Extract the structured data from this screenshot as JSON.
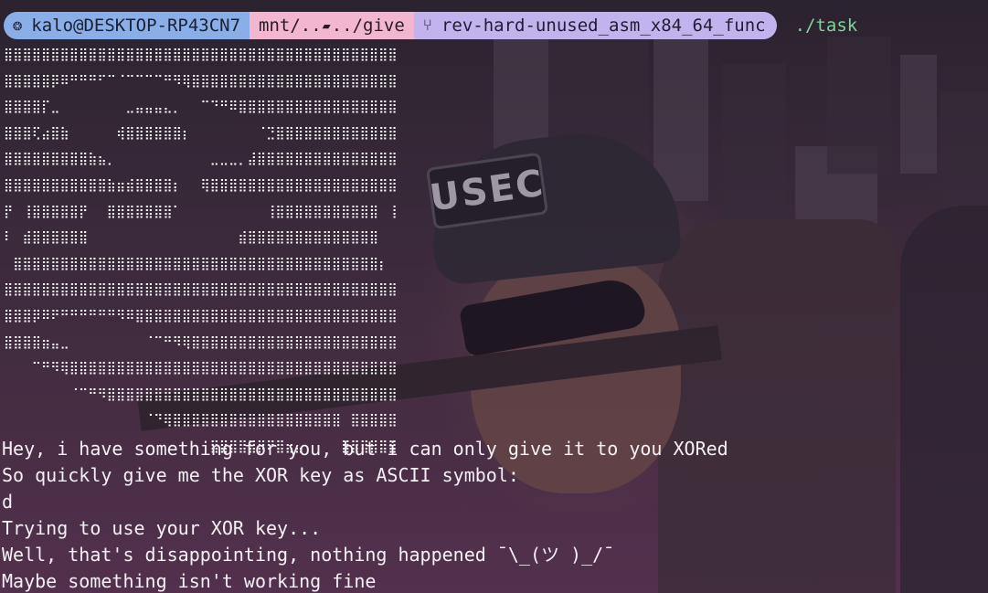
{
  "prompt": {
    "user_icon": "os-logo-icon",
    "user": "kalo@DESKTOP-RP43CN7",
    "path_start": "mnt/..",
    "path_icon": "folder-icon",
    "path_end": "../give",
    "branch_icon": "git-branch-icon",
    "branch": "rev-hard-unused_asm_x84_64_func",
    "command": "./task"
  },
  "ascii_art": [
    "⣿⣿⣿⣿⣿⣿⣿⣿⣿⣿⣿⣿⣿⣿⣿⣿⣿⣿⣿⣿⣿⣿⣿⣿⣿⣿⣿⣿⣿⣿⣿⣿⣿⣿⣿⣿⣿⣿⣿⣿⣿⣿",
    "⣿⣿⣿⣿⣿⡿⠿⠛⠛⠛⠋⠉⠈⠉⠉⠉⠉⠛⠻⢿⣿⣿⣿⣿⣿⣿⣿⣿⣿⣿⣿⣿⣿⣿⣿⣿⣿⣿⣿⣿⣿⣿",
    "⣿⣿⣿⣿⡏⣀⠀⠀⠀⠀⠀⠀⠀⣀⣤⣤⣤⣄⡀⠀⠀⠉⠙⠛⠿⣿⣿⣿⣿⣿⣿⣿⣿⣿⣿⣿⣿⣿⣿⣿⣿⣿",
    "⣿⣿⣿⢏⣴⣿⣷⠀⠀⠀⠀⠀⢾⣿⣿⣿⣿⣿⣿⡆⠀⠀⠀⠀⠀⠀⠀⠈⣙⣿⣿⣿⣿⣿⣿⣿⣿⣿⣿⣿⣿⣿",
    "⣿⣿⣿⣿⣿⣿⣿⣿⣿⣷⣦⡀⠀⠀⠀⠀⠀⠀⠀⠀⠀⠀⣀⣀⣀⡀⣼⣿⣿⣿⣿⣿⣿⣿⣿⣿⣿⣿⣿⣿⣿⣿",
    "⣿⣿⣿⣿⣿⣿⣿⣿⣿⣿⣿⣷⣶⣾⣿⣿⣿⣿⡆⠀⠀⢿⣿⣿⣿⣿⣿⣿⣿⣿⣿⣿⣿⣿⣿⣿⣿⣿⣿⣿⣿⣿",
    "⡟⠀⢸⣿⣿⣿⣿⣿⡟⠀⠀⣿⣿⣿⣿⣿⣿⣿⠁⠀⠀⠀⠀⠀⠀⠀⠀⠀⢸⣿⣿⣿⣿⣿⣿⣿⣿⣿⣿⣿⠀⢸",
    "⠇⠀⣾⣿⣿⣿⣿⣿⣿⠀⠀⠀⠀⠀⠀⠀⠀⠀⠀⠀⠀⠀⠀⠀⠀⣾⣿⣿⣿⣿⣿⣿⣿⣿⣿⣿⣿⣿⣿⣿⠀⠀",
    "⠀⣿⣿⣿⣿⣿⣿⣿⣿⣿⣿⣿⣿⣿⣿⣿⣿⣿⣿⣿⣿⣿⣿⣿⣿⣿⣿⣿⣿⣿⣿⣿⣿⣿⣿⣿⣿⣿⣿⣿⡆⠀",
    "⣿⣿⣿⣿⣿⣿⣿⣿⣿⣿⣿⣿⣿⣿⣿⣿⣿⣿⣿⣿⣿⣿⣿⣿⣿⣿⣿⣿⣿⣿⣿⣿⣿⣿⣿⣿⣿⣿⣿⣿⣿⣿",
    "⣿⣿⣿⡿⠿⠟⠛⠛⠛⠛⠛⠛⠻⠿⣿⣿⣿⣿⣿⣿⣿⣿⣿⣿⣿⣿⣿⣿⣿⣿⣿⣿⣿⣿⣿⣿⣿⣿⣿⣿⣿⣿",
    "⣿⣿⣿⣿⣶⣤⣀⠀⠀⠀⠀⠀⠀⠀⠀⠈⠉⠛⠻⢿⣿⣿⣿⣿⣿⣿⣿⣿⣿⣿⣿⣿⣿⣿⣿⣿⣿⣿⣿⣿⣿⣿",
    "⠀⠀⠀⠉⠛⠻⢿⣿⣿⣿⣿⣿⣿⣿⣿⣿⣿⣿⣿⣿⣿⣿⣿⣿⣿⣿⣿⣿⣿⣿⣿⣿⣿⣿⣿⣿⣿⣿⣿⣿⣿⣿",
    "⠀⠀⠀⠀⠀⠀⠀⠈⠉⠛⠻⣿⣿⣿⣿⣿⣿⣿⣿⣿⣿⣿⣿⣿⣿⣿⣿⣿⣿⣿⣿⣿⣿⣿⣿⣿⣿⣿⣿⣿⣿⣿",
    "⠀⠀⠀⠀⠀⠀⠀⠀⠀⠀⠀⠀⠀⠀⠀⠈⠙⢿⣿⣿⣿⣿⣿⣿⣿⣿⣿⣿⣿⣿⣿⣿⣿⣿⣿⣿⠀⣿⣿⣿⣿⣿",
    "⠀⠀⠀⠀⠀⠀⠀⠀⠀⠀⠀⠀⠀⠀⠀⠀⠀⠀⠀⠀⠀⠀⣿⣿⣿⣿⣿⡿⠟⣿⣶⣤⠀⠀⠀⠀⣿⣿⣿⣿⣿⣿"
  ],
  "output_lines": [
    "Hey, i have something for you, but i can only give it to you XORed",
    "So quickly give me the XOR key as ASCII symbol:",
    "d",
    "Trying to use your XOR key...",
    "Well, that's disappointing, nothing happened ¯\\_(ツ )_/¯",
    "Maybe something isn't working fine"
  ]
}
